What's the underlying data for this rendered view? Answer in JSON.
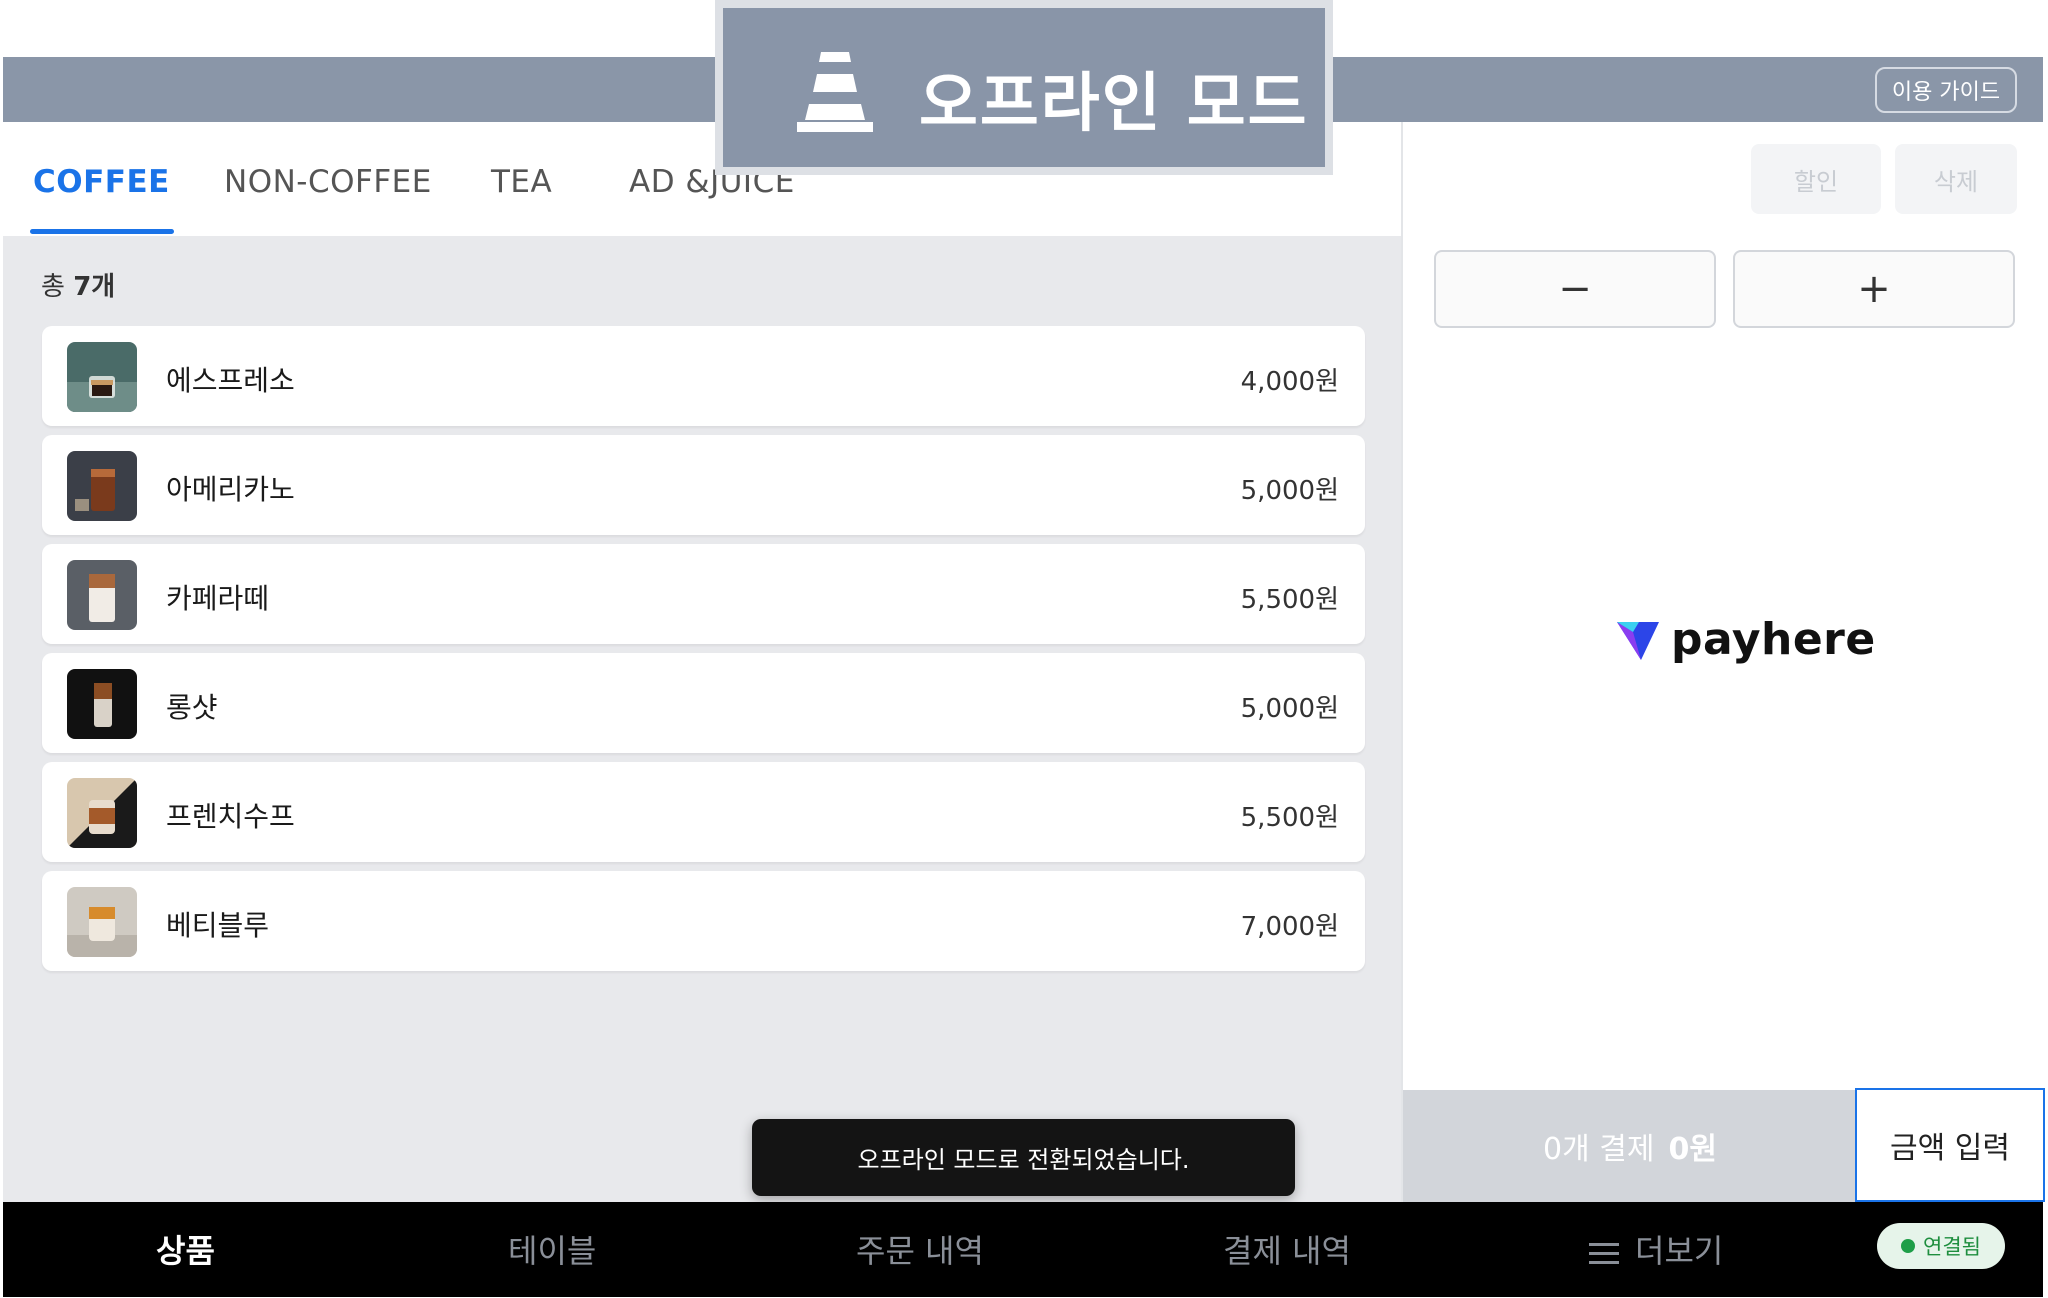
{
  "header": {
    "guide_label": "이용 가이드"
  },
  "offline_banner": {
    "text": "오프라인 모드",
    "icon": "traffic-cone-icon"
  },
  "tabs": [
    {
      "label": "COFFEE",
      "active": true
    },
    {
      "label": "NON-COFFEE",
      "active": false
    },
    {
      "label": "TEA",
      "active": false
    },
    {
      "label": "AD &JUICE",
      "active": false
    }
  ],
  "product_list": {
    "count_prefix": "총 ",
    "count_value": "7개",
    "items": [
      {
        "name": "에스프레소",
        "price": "4,000원"
      },
      {
        "name": "아메리카노",
        "price": "5,000원"
      },
      {
        "name": "카페라떼",
        "price": "5,500원"
      },
      {
        "name": "롱샷",
        "price": "5,000원"
      },
      {
        "name": "프렌치수프",
        "price": "5,500원"
      },
      {
        "name": "베티블루",
        "price": "7,000원"
      }
    ]
  },
  "toast": {
    "message": "오프라인 모드로 전환되었습니다."
  },
  "order_panel": {
    "discount_label": "할인",
    "delete_label": "삭제",
    "minus_label": "−",
    "plus_label": "+",
    "brand": "payhere",
    "pay_count": "0개 결제",
    "pay_amount": "0원",
    "amount_input_label": "금액 입력"
  },
  "bottom_nav": {
    "items": [
      {
        "label": "상품",
        "active": true
      },
      {
        "label": "테이블",
        "active": false
      },
      {
        "label": "주문 내역",
        "active": false
      },
      {
        "label": "결제 내역",
        "active": false
      },
      {
        "label": "더보기",
        "active": false
      }
    ],
    "connection_status": "연결됨"
  },
  "colors": {
    "accent": "#1a73e8",
    "topbar": "#8a96a8",
    "connected": "#1e9e48"
  }
}
